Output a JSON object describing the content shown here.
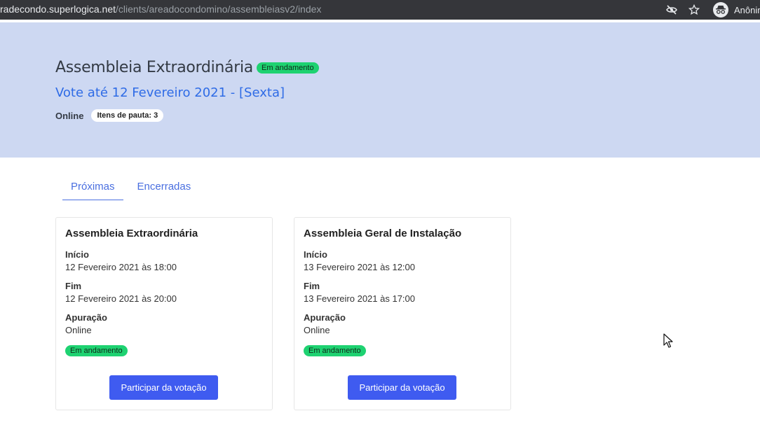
{
  "browser": {
    "url_host": "radecondo.superlogica.net",
    "url_path": "/clients/areadocondomino/assembleiasv2/index",
    "profile_name": "Anônim"
  },
  "hero": {
    "title": "Assembleia Extraordinária",
    "status_badge": "Em andamento",
    "vote_until": "Vote até 12 Fevereiro 2021 - [Sexta]",
    "mode": "Online",
    "items_badge": "Itens de pauta: 3"
  },
  "tabs": [
    {
      "label": "Próximas",
      "active": true
    },
    {
      "label": "Encerradas",
      "active": false
    }
  ],
  "labels": {
    "start": "Início",
    "end": "Fim",
    "counting": "Apuração"
  },
  "cards": [
    {
      "title": "Assembleia Extraordinária",
      "start": "12 Fevereiro 2021 às 18:00",
      "end": "12 Fevereiro 2021 às 20:00",
      "counting": "Online",
      "status": "Em andamento",
      "button": "Participar da votação"
    },
    {
      "title": "Assembleia Geral de Instalação",
      "start": "13 Fevereiro 2021 às 12:00",
      "end": "13 Fevereiro 2021 às 17:00",
      "counting": "Online",
      "status": "Em andamento",
      "button": "Participar da votação"
    }
  ],
  "colors": {
    "hero_bg": "#cdd8f2",
    "accent": "#3f5bf0",
    "status_green": "#1ed271"
  }
}
